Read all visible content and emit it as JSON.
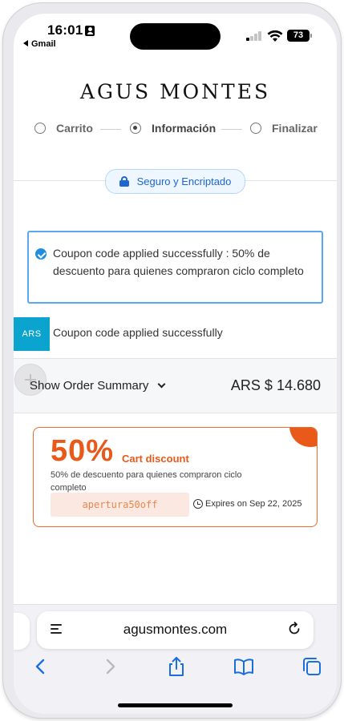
{
  "status_bar": {
    "time": "16:01",
    "back_app": "Gmail",
    "battery": "73"
  },
  "brand": {
    "name": "AGUS MONTES"
  },
  "checkout_steps": [
    {
      "label": "Carrito",
      "active": false
    },
    {
      "label": "Información",
      "active": true
    },
    {
      "label": "Finalizar",
      "active": false
    }
  ],
  "secure_badge": {
    "label": "Seguro y Encriptado",
    "icon": "lock-icon"
  },
  "coupon_notice": {
    "message": "Coupon code applied successfully : 50% de descuento para quienes compraron ciclo completo",
    "icon": "check-circle-icon"
  },
  "currency_row": {
    "badge": "ARS",
    "message": "Coupon code applied successfully"
  },
  "order_summary": {
    "toggle_label": "Show Order Summary",
    "total": "ARS $ 14.680"
  },
  "coupon_card": {
    "percent": "50%",
    "type_label": "Cart discount",
    "description": "50% de descuento para quienes compraron ciclo completo",
    "code": "apertura50off",
    "expires": "Expires on Sep 22, 2025",
    "accent_color": "#e8591a"
  },
  "browser": {
    "url": "agusmontes.com"
  },
  "colors": {
    "link_blue": "#1e66d0",
    "notice_border": "#5aa8f0",
    "ars_badge": "#0aa4cf"
  }
}
